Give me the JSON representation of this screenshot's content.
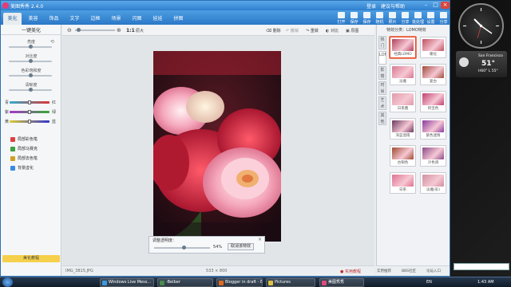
{
  "app": {
    "title": "美图秀秀 2.4.0",
    "window_links": [
      "登录",
      "建议与帮助"
    ]
  },
  "tabs": [
    "美化",
    "美容",
    "饰品",
    "文字",
    "边框",
    "场景",
    "闪图",
    "娃娃",
    "拼图"
  ],
  "toolbar": [
    "打开",
    "保存",
    "保存",
    "随机",
    "照片",
    "分享",
    "批处理",
    "设置",
    "分享"
  ],
  "left_panel": {
    "header": "一键美化",
    "sliders": [
      {
        "label": "亮度",
        "value": 0.5
      },
      {
        "label": "对比度",
        "value": 0.5
      },
      {
        "label": "色彩饱和度",
        "value": 0.5
      },
      {
        "label": "清晰度",
        "value": 0.5
      }
    ],
    "color_sliders": [
      {
        "left": "青",
        "right": "红",
        "value": 0.5
      },
      {
        "left": "紫",
        "right": "绿",
        "value": 0.5
      },
      {
        "left": "黄",
        "right": "蓝",
        "value": 0.5
      }
    ],
    "effects": [
      "局部彩色笔",
      "局部马赛克",
      "局部去色笔",
      "背景虚化"
    ],
    "tutorial_label": "美化教程"
  },
  "canvas": {
    "zoom_label": "1:1",
    "zoom_tools": [
      "原大",
      "删除",
      "撤销",
      "重做",
      "对比",
      "原图"
    ],
    "opacity_label": "调整透明度：",
    "opacity_value": "54%",
    "opacity_fraction": 0.54,
    "opacity_button": "取消该特效",
    "filename": "IMG_3815.JPG",
    "dimensions": "533 × 800"
  },
  "right_panel": {
    "header": "特效分类：LOMO特效",
    "vtabs": [
      "热门",
      "LOMO",
      "影楼",
      "时尚",
      "艺术",
      "其他"
    ],
    "selected_vtab": 1,
    "effects": [
      {
        "label": "经典LOMO",
        "color": "#b0405a"
      },
      {
        "label": "暖化",
        "color": "#c05060"
      },
      {
        "label": "淡雅",
        "color": "#d87890"
      },
      {
        "label": "复古",
        "color": "#a04a3a"
      },
      {
        "label": "日系圈",
        "color": "#e09aa8"
      },
      {
        "label": "阿宝色",
        "color": "#c04070"
      },
      {
        "label": "深蓝泪雨",
        "color": "#6a3a60"
      },
      {
        "label": "紫色迷情",
        "color": "#8a3aa0"
      },
      {
        "label": "古铜色",
        "color": "#a04a30"
      },
      {
        "label": "冷色调",
        "color": "#8a4a8a"
      },
      {
        "label": "日系",
        "color": "#e07090"
      },
      {
        "label": "淡雅(彩)",
        "color": "#d090a0"
      }
    ],
    "selected_effect": 0
  },
  "status": {
    "links": [
      "实用教程",
      "实用推荐",
      "BBS社区",
      "论坛入口"
    ]
  },
  "gadgets": {
    "weather_city": "San Francisco",
    "weather_temp": "51°",
    "weather_range": "H60° L 55°"
  },
  "taskbar": {
    "items": [
      {
        "label": "Windows Live Mess...",
        "color": "#3a9ae0"
      },
      {
        "label": "-Beiber",
        "color": "#4a8a4a"
      },
      {
        "label": "Blogger in draft - E...",
        "color": "#e06a20"
      },
      {
        "label": "Pictures",
        "color": "#e0c040"
      },
      {
        "label": "美图秀秀",
        "color": "#e04a7a"
      }
    ],
    "lang": "EN",
    "time": "1:43 AM"
  }
}
